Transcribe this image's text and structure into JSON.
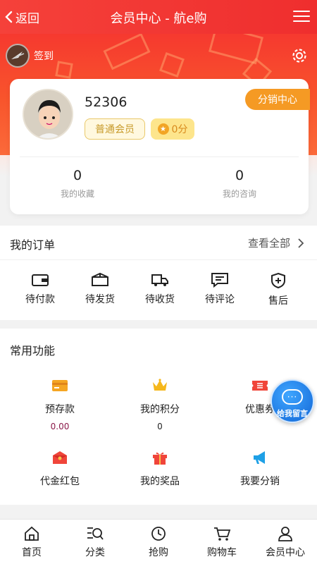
{
  "header": {
    "back_label": "返回",
    "title": "会员中心 - 航e购"
  },
  "hero": {
    "signin_label": "签到"
  },
  "user": {
    "name": "52306",
    "level": "普通会员",
    "points": "0分",
    "distribution_button": "分销中心",
    "stats": [
      {
        "value": "0",
        "label": "我的收藏"
      },
      {
        "value": "0",
        "label": "我的咨询"
      }
    ]
  },
  "orders": {
    "title": "我的订单",
    "view_all": "查看全部",
    "items": [
      {
        "label": "待付款",
        "icon": "wallet-icon"
      },
      {
        "label": "待发货",
        "icon": "box-icon"
      },
      {
        "label": "待收货",
        "icon": "truck-icon"
      },
      {
        "label": "待评论",
        "icon": "comment-icon"
      },
      {
        "label": "售后",
        "icon": "shield-plus-icon"
      }
    ]
  },
  "functions": {
    "title": "常用功能",
    "items": [
      {
        "label": "预存款",
        "value": "0.00",
        "icon": "card-icon",
        "color": "#f5a623"
      },
      {
        "label": "我的积分",
        "value": "0",
        "icon": "crown-icon",
        "color": "#f5b71c"
      },
      {
        "label": "优惠券",
        "icon": "coupon-icon",
        "color": "#f0453a"
      },
      {
        "label": "代金红包",
        "icon": "red-envelope-icon",
        "color": "#f0453a"
      },
      {
        "label": "我的奖品",
        "icon": "gift-icon",
        "color": "#f0453a"
      },
      {
        "label": "我要分销",
        "icon": "megaphone-icon",
        "color": "#1ea0e6"
      }
    ]
  },
  "floating": {
    "label": "给我留言",
    "dots": "···"
  },
  "tabbar": {
    "items": [
      {
        "label": "首页",
        "icon": "home-icon"
      },
      {
        "label": "分类",
        "icon": "category-search-icon"
      },
      {
        "label": "抢购",
        "icon": "clock-icon"
      },
      {
        "label": "购物车",
        "icon": "cart-icon"
      },
      {
        "label": "会员中心",
        "icon": "user-icon"
      }
    ]
  },
  "colors": {
    "primary": "#ef2e2e",
    "accent": "#f59a24",
    "deposit_value": "#8b1a4a"
  }
}
